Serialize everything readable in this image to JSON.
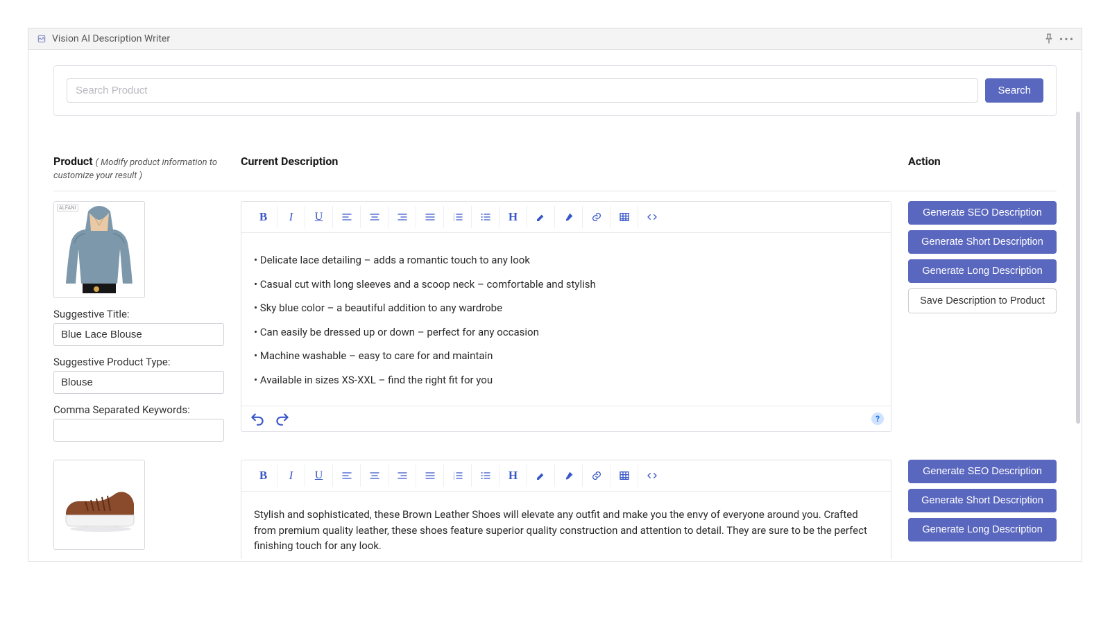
{
  "header": {
    "title": "Vision AI Description Writer"
  },
  "search": {
    "placeholder": "Search Product",
    "button": "Search"
  },
  "columns": {
    "product_heading": "Product",
    "product_hint": "( Modify product information to customize your result )",
    "desc_heading": "Current Description",
    "action_heading": "Action"
  },
  "actions": {
    "seo": "Generate SEO Description",
    "short": "Generate Short Description",
    "long": "Generate Long Description",
    "save": "Save Description to Product"
  },
  "labels": {
    "suggestive_title": "Suggestive Title:",
    "suggestive_type": "Suggestive Product Type:",
    "keywords": "Comma Separated Keywords:"
  },
  "products": [
    {
      "title_value": "Blue Lace Blouse",
      "type_value": "Blouse",
      "keywords_value": "",
      "image_label": "blue-lace-blouse-image",
      "description_bullets": [
        "• Delicate lace detailing – adds a romantic touch to any look",
        "• Casual cut with long sleeves and a scoop neck – comfortable and stylish",
        "• Sky blue color – a beautiful addition to any wardrobe",
        "• Can easily be dressed up or down – perfect for any occasion",
        "• Machine washable – easy to care for and maintain",
        "• Available in sizes XS-XXL – find the right fit for you"
      ]
    },
    {
      "image_label": "brown-leather-shoe-image",
      "description_paragraph": "Stylish and sophisticated, these Brown Leather Shoes will elevate any outfit and make you the envy of everyone around you. Crafted from premium quality leather, these shoes feature superior quality construction and attention to detail. They are sure to be the perfect finishing touch for any look."
    }
  ],
  "colors": {
    "accent": "#5a67bf",
    "toolbar_icon": "#3857c9"
  }
}
